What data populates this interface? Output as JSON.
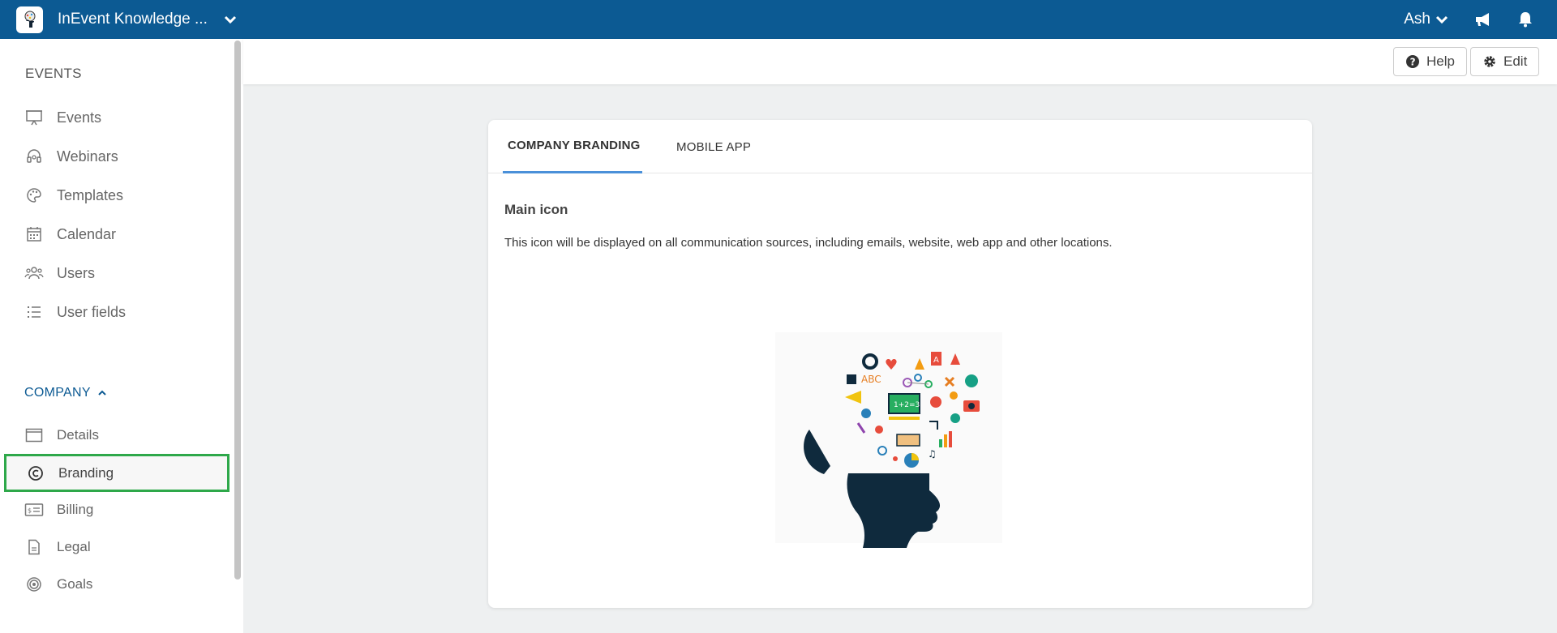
{
  "topbar": {
    "app_title": "InEvent Knowledge ...",
    "user_name": "Ash",
    "color": "#0c5a93"
  },
  "sidebar": {
    "events_heading": "EVENTS",
    "events_items": [
      {
        "label": "Events",
        "icon": "presentation-icon"
      },
      {
        "label": "Webinars",
        "icon": "headset-icon"
      },
      {
        "label": "Templates",
        "icon": "palette-icon"
      },
      {
        "label": "Calendar",
        "icon": "calendar-icon"
      },
      {
        "label": "Users",
        "icon": "users-icon"
      },
      {
        "label": "User fields",
        "icon": "list-icon"
      }
    ],
    "company_heading": "COMPANY",
    "company_items": [
      {
        "label": "Details",
        "icon": "window-icon"
      },
      {
        "label": "Branding",
        "icon": "copyright-icon",
        "active": true
      },
      {
        "label": "Billing",
        "icon": "billing-icon"
      },
      {
        "label": "Legal",
        "icon": "document-icon"
      },
      {
        "label": "Goals",
        "icon": "target-icon"
      }
    ],
    "active_highlight_color": "#2ea84a"
  },
  "header": {
    "help_label": "Help",
    "edit_label": "Edit"
  },
  "card": {
    "tabs": [
      {
        "label": "COMPANY BRANDING",
        "active": true
      },
      {
        "label": "MOBILE APP",
        "active": false
      }
    ],
    "section_title": "Main icon",
    "section_desc": "This icon will be displayed on all communication sources, including emails, website, web app and other locations.",
    "tab_accent_color": "#4a90d9"
  }
}
